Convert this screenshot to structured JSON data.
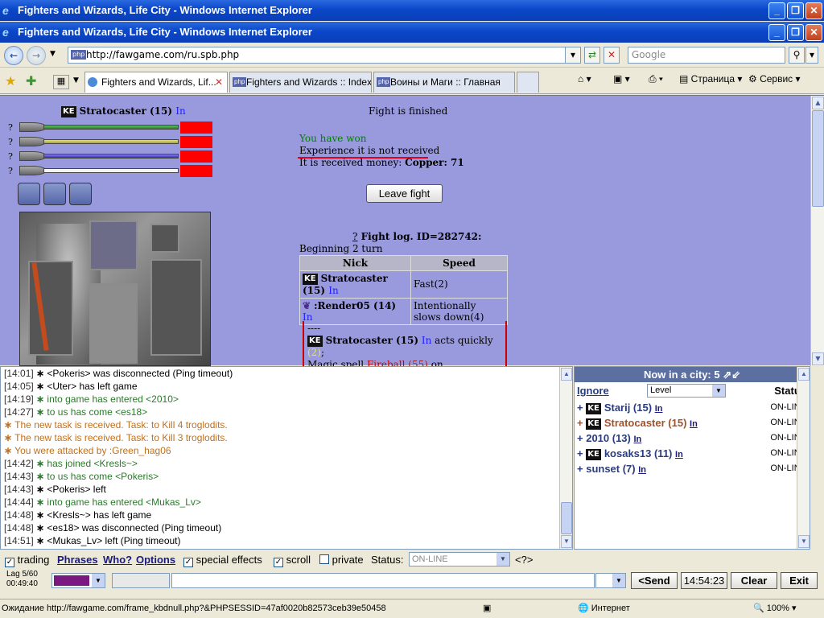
{
  "window": {
    "title_outer": "Fighters and Wizards, Life City - Windows Internet Explorer",
    "title_inner": "Fighters and Wizards, Life City - Windows Internet Explorer"
  },
  "address": {
    "url": "http://fawgame.com/ru.spb.php",
    "search_placeholder": "Google"
  },
  "tabs": [
    {
      "label": "Fighters and Wizards, Lif..."
    },
    {
      "label": "Fighters and Wizards :: Index"
    },
    {
      "label": "Воины и Маги :: Главная"
    }
  ],
  "toolbar": {
    "page": "Страница",
    "service": "Сервис"
  },
  "player": {
    "name": "Stratocaster (15)",
    "in": "In",
    "clan": "KE",
    "bar_marks": [
      "?",
      "?",
      "?",
      "?"
    ],
    "bar_colors": [
      "#3b9d3b",
      "#c9c35a",
      "#5b4fd0",
      "#eeeeee"
    ]
  },
  "fight": {
    "title": "Fight is finished",
    "won": "You have won",
    "experience": "Experience it is not received",
    "money_label": "It is received money:",
    "money_value": "Copper: 71",
    "leave_button": "Leave fight",
    "log_q": "?",
    "log_title": "Fight log. ID=282742:",
    "beginning": "Beginning 2 turn",
    "table_headers": [
      "Nick",
      "Speed"
    ],
    "table_rows": [
      {
        "nick": "Stratocaster (15)",
        "in": "In",
        "speed": "Fast(2)"
      },
      {
        "nick": ":Render05 (14)",
        "in": "In",
        "speed": "Intentionally slows down(4)"
      }
    ],
    "log_dash": "----",
    "log_actor": "Stratocaster (15)",
    "log_in": "In",
    "log_acts": "acts quickly",
    "log_acts_n": "(2)",
    "log_colon": ";",
    "log_magic": "Magic spell",
    "log_spell": "Fireball",
    "log_spell_n": "(55)",
    "log_on": "on"
  },
  "chat": {
    "lines": [
      {
        "t": "[14:01]",
        "txt": " <Pokeris> was disconnected (Ping timeout)",
        "cls": ""
      },
      {
        "t": "[14:05]",
        "txt": " <Uter> has left game",
        "cls": ""
      },
      {
        "t": "[14:19]",
        "txt": " into game has entered <2010>",
        "cls": "g"
      },
      {
        "t": "[14:27]",
        "txt": " to us has come <es18>",
        "cls": "g"
      },
      {
        "t": "",
        "txt": " The new task is received. Task: to Kill 4 troglodits.",
        "cls": "b"
      },
      {
        "t": "",
        "txt": " The new task is received. Task: to Kill 3 troglodits.",
        "cls": "b"
      },
      {
        "t": "",
        "txt": " You were attacked by :Green_hag06",
        "cls": "b"
      },
      {
        "t": "[14:42]",
        "txt": " has joined <Kresls~>",
        "cls": "g"
      },
      {
        "t": "[14:43]",
        "txt": " to us has come <Pokeris>",
        "cls": "g"
      },
      {
        "t": "[14:43]",
        "txt": " <Pokeris> left",
        "cls": ""
      },
      {
        "t": "[14:44]",
        "txt": " into game has entered <Mukas_Lv>",
        "cls": "g"
      },
      {
        "t": "[14:48]",
        "txt": " <Kresls~> has left game",
        "cls": ""
      },
      {
        "t": "[14:48]",
        "txt": " <es18> was disconnected (Ping timeout)",
        "cls": ""
      },
      {
        "t": "[14:51]",
        "txt": " <Mukas_Lv> left (Ping timeout)",
        "cls": ""
      }
    ]
  },
  "who": {
    "header": "Now in a city: 5",
    "ignore": "Ignore",
    "level": "Level",
    "status": "Status",
    "users": [
      {
        "plus": "+",
        "name": "Starij (15)",
        "in": "In",
        "status": "ON-LINE",
        "clan": "KE",
        "self": false
      },
      {
        "plus": "+",
        "name": "Stratocaster (15)",
        "in": "In",
        "status": "ON-LINE",
        "clan": "KE",
        "self": true
      },
      {
        "plus": "+",
        "name": "2010 (13)",
        "in": "In",
        "status": "ON-LINE",
        "clan": "",
        "self": false
      },
      {
        "plus": "+",
        "name": "kosaks13 (11)",
        "in": "In",
        "status": "ON-LINE",
        "clan": "KE",
        "self": false
      },
      {
        "plus": "+",
        "name": "sunset (7)",
        "in": "In",
        "status": "ON-LINE",
        "clan": "",
        "self": false
      }
    ]
  },
  "controls": {
    "trading": "trading",
    "phrases": "Phrases",
    "who": "Who?",
    "options": "Options",
    "special": "special effects",
    "scroll": "scroll",
    "private": "private",
    "status_label": "Status:",
    "status_value": "ON-LINE",
    "help": "<?>",
    "lag": "Lag 5/60",
    "timer": "00:49:40",
    "send": "<Send",
    "time": "14:54:23",
    "clear": "Clear",
    "exit": "Exit"
  },
  "statusbar": {
    "text": "Ожидание http://fawgame.com/frame_kbdnull.php?&PHPSESSID=47af0020b82573ceb39e50458",
    "zone": "Интернет",
    "zoom": "100%"
  }
}
